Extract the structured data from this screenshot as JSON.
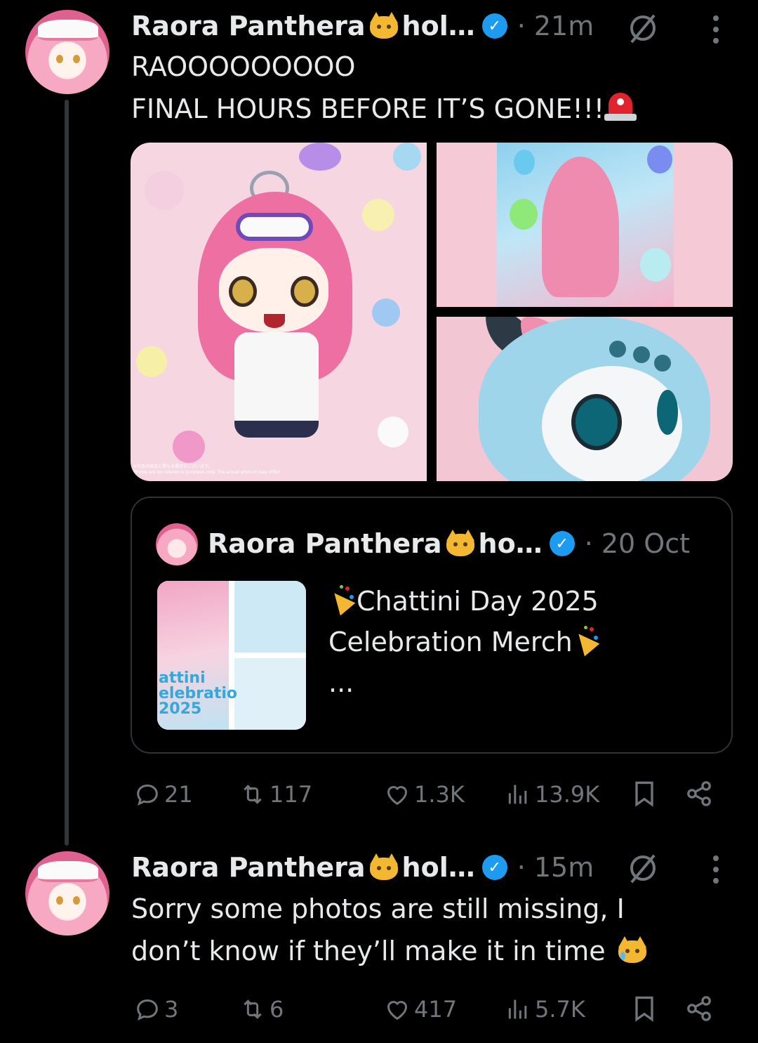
{
  "posts": [
    {
      "author": {
        "display_name": "Raora Panthera",
        "handle_truncated": "hol…"
      },
      "time": "· 21m",
      "lines": [
        "RAOOOOOOOOO",
        "FINAL HOURS BEFORE IT’S GONE!!!"
      ],
      "media_disclaimer": [
        "※写真の商品と異なる場合がございます。",
        "Photos are for reference purposes only. The actual product may differ."
      ],
      "quoted_post": {
        "author": {
          "display_name": "Raora Panthera",
          "handle_truncated": "ho…"
        },
        "date": "· 20 Oct",
        "lines": [
          "Chattini Day 2025",
          "Celebration Merch",
          "..."
        ],
        "thumb_logo": [
          "attini",
          "elebratio",
          "2025"
        ]
      },
      "stats": {
        "replies": "21",
        "reposts": "117",
        "likes": "1.3K",
        "views": "13.9K"
      }
    },
    {
      "author": {
        "display_name": "Raora Panthera",
        "handle_truncated": "hol…"
      },
      "time": "· 15m",
      "lines": [
        "Sorry some photos are still missing, I",
        "don’t know if they’ll make it in time"
      ],
      "stats": {
        "replies": "3",
        "reposts": "6",
        "likes": "417",
        "views": "5.7K"
      }
    }
  ],
  "icons": {
    "verified": "verified-badge-icon",
    "grok": "grok-icon",
    "more": "more-options-icon",
    "reply": "reply-icon",
    "repost": "repost-icon",
    "like": "like-icon",
    "views": "views-icon",
    "bookmark": "bookmark-icon",
    "share": "share-icon"
  },
  "colors": {
    "background": "#000000",
    "text": "#e7e9ea",
    "muted": "#71767b",
    "verified": "#1d9bf0",
    "border": "#2f3336"
  }
}
